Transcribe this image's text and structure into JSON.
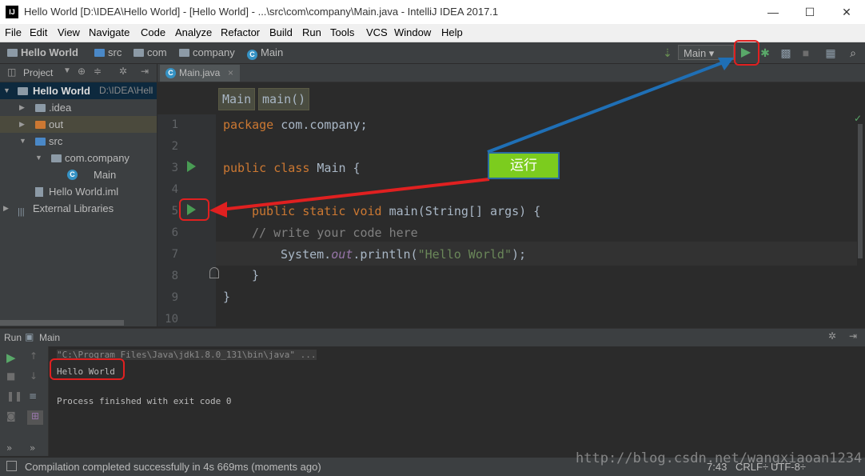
{
  "window": {
    "title": "Hello World [D:\\IDEA\\Hello World] - [Hello World] - ...\\src\\com\\company\\Main.java - IntelliJ IDEA 2017.1",
    "logo_text": "IJ",
    "minimize": "—",
    "maximize": "☐",
    "close": "✕"
  },
  "menu": [
    "File",
    "Edit",
    "View",
    "Navigate",
    "Code",
    "Analyze",
    "Refactor",
    "Build",
    "Run",
    "Tools",
    "VCS",
    "Window",
    "Help"
  ],
  "navbar": {
    "crumbs": [
      "Hello World",
      "src",
      "com",
      "company",
      "Main"
    ],
    "run_config": "Main"
  },
  "project": {
    "header": "Project",
    "tree": [
      {
        "label": "Hello World",
        "path": "D:\\IDEA\\Hell"
      },
      {
        "label": ".idea"
      },
      {
        "label": "out"
      },
      {
        "label": "src"
      },
      {
        "label": "com.company"
      },
      {
        "label": "Main"
      },
      {
        "label": "Hello World.iml"
      },
      {
        "label": "External Libraries"
      }
    ]
  },
  "editor": {
    "tab": "Main.java",
    "breadcrumbs": [
      "Main",
      "main()"
    ],
    "line_numbers": [
      "1",
      "2",
      "3",
      "4",
      "5",
      "6",
      "7",
      "8",
      "9",
      "10"
    ],
    "code": {
      "l1_kw": "package",
      "l1_rest": " com.company;",
      "l3_kw": "public class",
      "l3_rest": " Main {",
      "l5_kw": "public static void",
      "l5_rest": " main(String[] args) {",
      "l6": "// write your code here",
      "l7_a": "System.",
      "l7_b": "out",
      "l7_c": ".println(",
      "l7_str": "\"Hello World\"",
      "l7_d": ");",
      "l8": "}",
      "l9": "}"
    }
  },
  "run_panel": {
    "label": "Run",
    "config": "Main",
    "command": "\"C:\\Program Files\\Java\\jdk1.8.0_131\\bin\\java\" ...",
    "output": "Hello World",
    "exit": "Process finished with exit code 0"
  },
  "status": {
    "message": "Compilation completed successfully in 4s 669ms (moments ago)",
    "position": "7:43",
    "line_sep": "CRLF÷",
    "encoding": "UTF-8÷"
  },
  "annotation": {
    "label": "运行",
    "arrow_color_blue": "#1f6fb5",
    "arrow_color_red": "#e02020"
  },
  "watermark": "http://blog.csdn.net/wangxiaoan1234"
}
